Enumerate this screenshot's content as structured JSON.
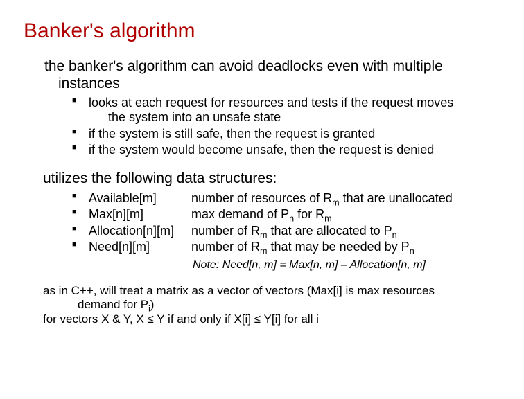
{
  "title": "Banker's algorithm",
  "intro_l1": "the banker's algorithm can avoid deadlocks even with multiple",
  "intro_l2": "instances",
  "bullets": {
    "b1_l1": "looks at each request for resources and tests if the request moves",
    "b1_l2": "the system into an unsafe state",
    "b2": "if the system is still safe, then the request is granted",
    "b3": "if the system would become unsafe, then the request is denied"
  },
  "utilizes": "utilizes the following data structures:",
  "ds": [
    {
      "name": "Available[m]",
      "desc_pre": "number of resources of R",
      "sub": "m",
      "desc_post": " that are unallocated"
    },
    {
      "name": "Max[n][m]",
      "desc_pre": "max demand of P",
      "sub": "n",
      "desc_mid": " for R",
      "sub2": "m",
      "desc_post": ""
    },
    {
      "name": "Allocation[n][m]",
      "desc_pre": "number of R",
      "sub": "m",
      "desc_mid": " that are allocated to P",
      "sub2": "n",
      "desc_post": ""
    },
    {
      "name": "Need[n][m]",
      "desc_pre": "number of R",
      "sub": "m",
      "desc_mid": " that may be needed by P",
      "sub2": "n",
      "desc_post": ""
    }
  ],
  "note": "Note: Need[n, m] = Max[n, m] – Allocation[n, m]",
  "footer": {
    "l1": "as in C++, will treat a matrix as a vector of vectors (Max[i] is max resources",
    "l2_pre": "demand for P",
    "l2_sub": "i",
    "l2_post": ")",
    "l3": "for vectors X & Y, X ≤ Y if and only if X[i] ≤ Y[i] for all i"
  }
}
